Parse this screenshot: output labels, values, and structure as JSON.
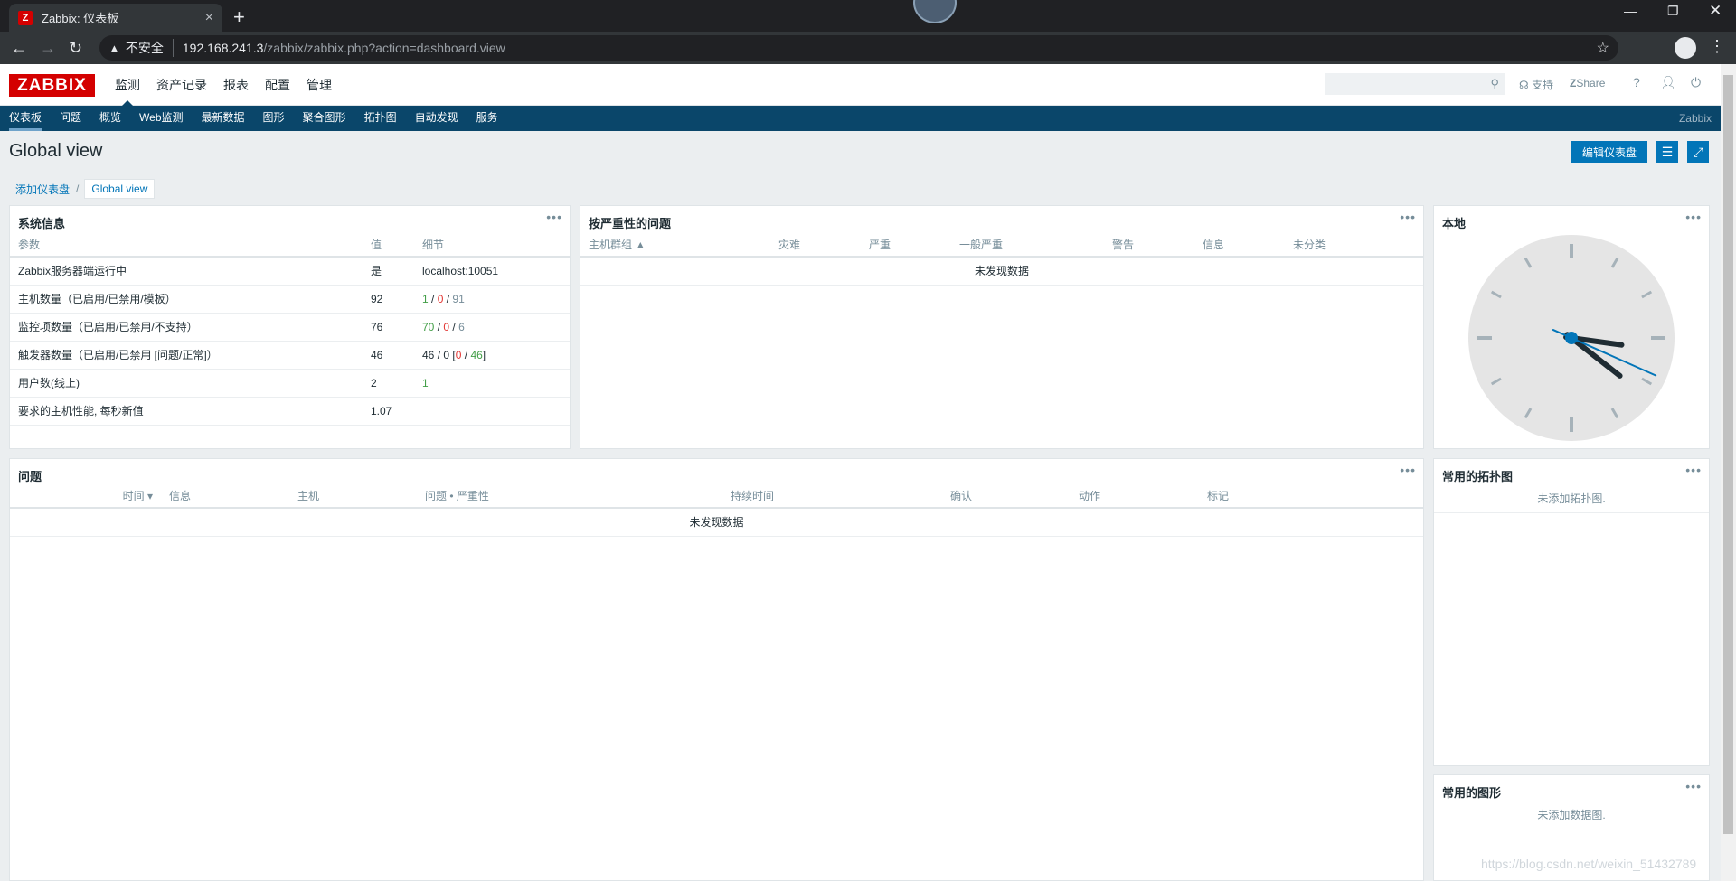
{
  "browser": {
    "tab_title": "Zabbix: 仪表板",
    "favicon_letter": "Z",
    "new_tab": "+",
    "not_secure": "不安全",
    "url_host": "192.168.241.3",
    "url_path": "/zabbix/zabbix.php?action=dashboard.view"
  },
  "header": {
    "logo": "ZABBIX",
    "menu": [
      "监测",
      "资产记录",
      "报表",
      "配置",
      "管理"
    ],
    "support": "支持",
    "share": "Share",
    "help": "?"
  },
  "submenu": {
    "items": [
      "仪表板",
      "问题",
      "概览",
      "Web监测",
      "最新数据",
      "图形",
      "聚合图形",
      "拓扑图",
      "自动发现",
      "服务"
    ],
    "server_name": "Zabbix"
  },
  "page": {
    "title": "Global view",
    "edit_button": "编辑仪表盘",
    "breadcrumb_parent": "添加仪表盘",
    "breadcrumb_sep": "/",
    "breadcrumb_current": "Global view"
  },
  "system_info": {
    "title": "系统信息",
    "headers": [
      "参数",
      "值",
      "细节"
    ],
    "rows": [
      {
        "param": "Zabbix服务器端运行中",
        "value": "是",
        "detail": "localhost:10051"
      },
      {
        "param": "主机数量（已启用/已禁用/模板）",
        "value": "92",
        "d1": "1",
        "d2": "0",
        "d3": "91"
      },
      {
        "param": "监控项数量（已启用/已禁用/不支持）",
        "value": "76",
        "d1": "70",
        "d2": "0",
        "d3": "6"
      },
      {
        "param": "触发器数量（已启用/已禁用 [问题/正常]）",
        "value": "46",
        "d1": "46",
        "d2": "0",
        "d3": "0",
        "d4": "46"
      },
      {
        "param": "用户数(线上)",
        "value": "2",
        "d1": "1"
      },
      {
        "param": "要求的主机性能, 每秒新值",
        "value": "1.07"
      }
    ]
  },
  "problems_by_severity": {
    "title": "按严重性的问题",
    "headers": [
      "主机群组 ▲",
      "灾难",
      "严重",
      "一般严重",
      "警告",
      "信息",
      "未分类"
    ],
    "empty": "未发现数据"
  },
  "clock": {
    "title": "本地",
    "hour": 4,
    "minute": 16,
    "second": 19
  },
  "problems": {
    "title": "问题",
    "headers": [
      "时间 ▾",
      "信息",
      "主机",
      "问题 • 严重性",
      "持续时间",
      "确认",
      "动作",
      "标记"
    ],
    "empty": "未发现数据"
  },
  "fav_maps": {
    "title": "常用的拓扑图",
    "empty": "未添加拓扑图."
  },
  "fav_graphs": {
    "title": "常用的图形",
    "empty": "未添加数据图."
  },
  "watermark": "https://blog.csdn.net/weixin_51432789",
  "colors": {
    "brand_red": "#d40000",
    "nav_blue": "#0a466a",
    "button_blue": "#0275b8",
    "ok_green": "#429e47",
    "problem_red": "#e33734"
  }
}
